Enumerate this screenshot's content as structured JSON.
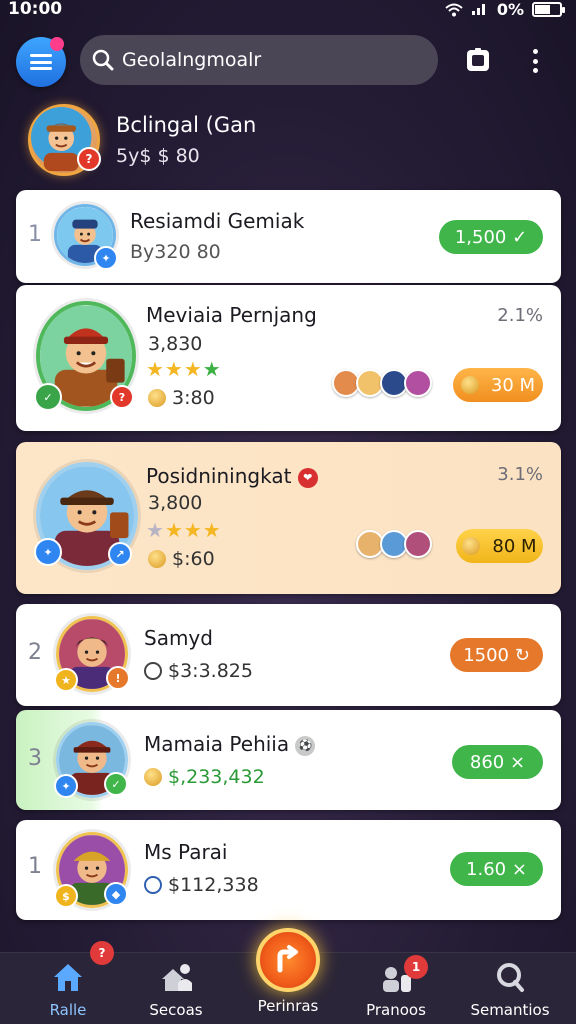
{
  "status_bar": {
    "time": "10:00",
    "battery": "0%"
  },
  "search": {
    "placeholder": "Geolalngmoalr"
  },
  "profile": {
    "name": "Bclingal (Gan",
    "subtitle": "5y$ $ 80"
  },
  "leaderboard": [
    {
      "rank": "1",
      "name": "Resiamdi Gemiak",
      "sub": "By320 80",
      "pill": "1,500 ✓",
      "pill_color": "green"
    },
    {
      "rank": "",
      "name": "Meviaia Pernjang",
      "score": "3,830",
      "coins": "3:80",
      "percent": "2.1%",
      "stars": 4,
      "pill": "30 M",
      "pill_color": "amber"
    },
    {
      "rank": "",
      "name": "Posidniningkat",
      "score": "3,800",
      "coins": "$:60",
      "percent": "3.1%",
      "stars": 4,
      "pill": "80 M",
      "pill_color": "gold"
    },
    {
      "rank": "2",
      "name": "Samyd",
      "sub": "$3:3.825",
      "pill": "1500 ↻",
      "pill_color": "orange"
    },
    {
      "rank": "3",
      "name": "Mamaia Pehiia",
      "sub": "$,233,432",
      "pill": "860 ×",
      "pill_color": "green"
    },
    {
      "rank": "1",
      "name": "Ms Parai",
      "sub": "$112,338",
      "pill": "1.60 ×",
      "pill_color": "green"
    }
  ],
  "bottom_nav": [
    {
      "label": "Ralle",
      "badge": "?"
    },
    {
      "label": "Secoas",
      "badge": ""
    },
    {
      "label": "Perinras",
      "badge": ""
    },
    {
      "label": "Pranoos",
      "badge": "1"
    },
    {
      "label": "Semantios",
      "badge": ""
    }
  ],
  "colors": {
    "accent_blue": "#2f86f0",
    "green": "#3fb54a",
    "orange": "#e5782a",
    "gold": "#f1b51a",
    "highlight": "#fde6c8"
  }
}
